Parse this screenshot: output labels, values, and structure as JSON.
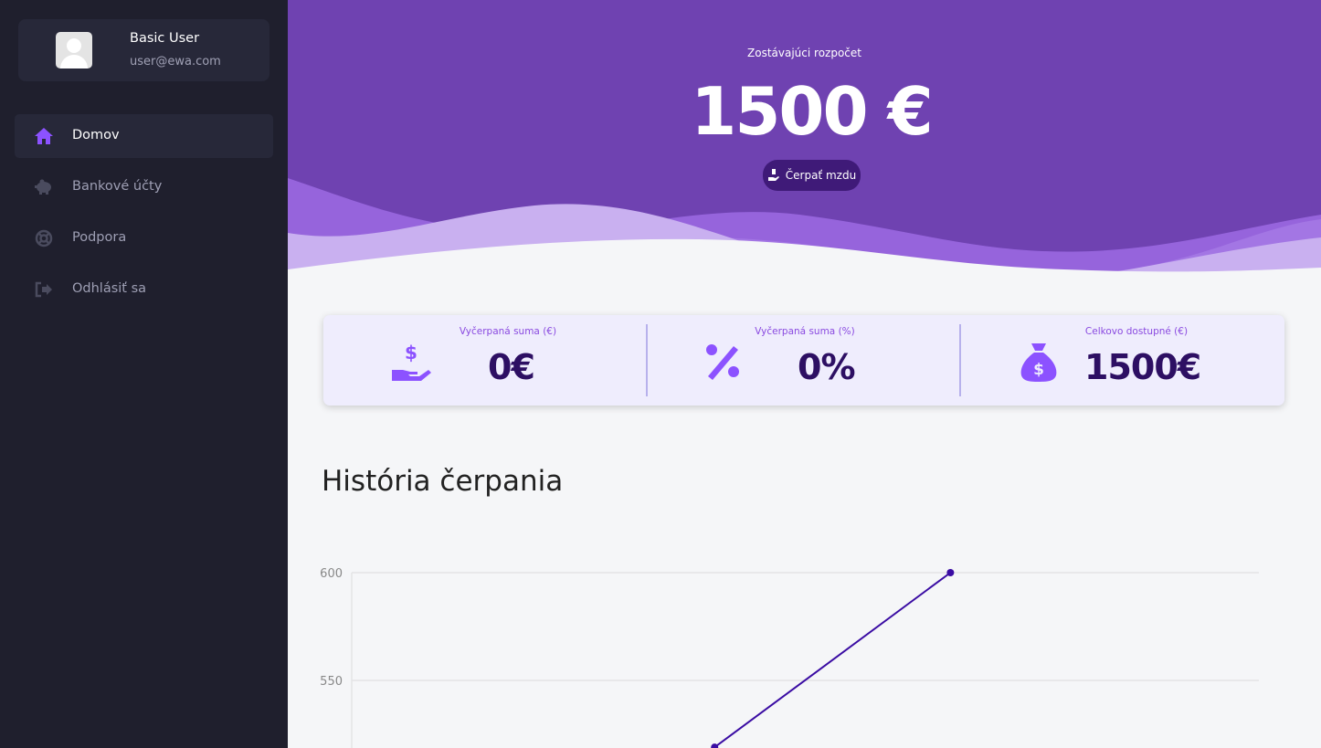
{
  "sidebar": {
    "user": {
      "name": "Basic User",
      "email": "user@ewa.com"
    },
    "items": [
      {
        "label": "Domov",
        "icon": "home-icon",
        "active": true
      },
      {
        "label": "Bankové účty",
        "icon": "piggy-bank-icon",
        "active": false
      },
      {
        "label": "Podpora",
        "icon": "lifebuoy-icon",
        "active": false
      },
      {
        "label": "Odhlásiť sa",
        "icon": "logout-icon",
        "active": false
      }
    ]
  },
  "hero": {
    "label": "Zostávajúci rozpočet",
    "value": "1500 €",
    "button_label": "Čerpať mzdu"
  },
  "stats": [
    {
      "caption": "Vyčerpaná suma (€)",
      "value": "0€",
      "icon": "hand-dollar-icon"
    },
    {
      "caption": "Vyčerpaná suma (%)",
      "value": "0%",
      "icon": "percent-icon"
    },
    {
      "caption": "Celkovo dostupné (€)",
      "value": "1500€",
      "icon": "money-bag-icon"
    }
  ],
  "history": {
    "title": "História čerpania"
  },
  "colors": {
    "accent": "#7c4ddb",
    "hero": "#6f42b1",
    "sidebar": "#1f1f2d",
    "line": "#3a0ca3"
  },
  "chart_data": {
    "type": "line",
    "yticks": [
      600,
      550
    ],
    "ylim": [
      500,
      600
    ],
    "xlim": [
      0,
      1
    ],
    "series": [
      {
        "x": [
          0.4,
          0.66
        ],
        "y": [
          519,
          600
        ]
      }
    ]
  }
}
